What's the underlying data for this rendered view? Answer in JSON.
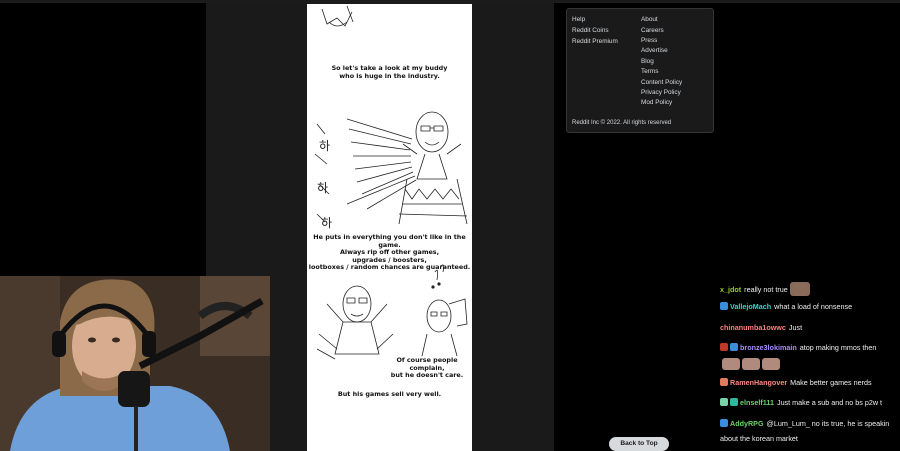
{
  "comic": {
    "captions": [
      {
        "lines": [
          "So let's take a look at my buddy",
          "who is huge in the industry."
        ]
      },
      {
        "lines": [
          "He puts in everything you don't like in the game.",
          "Always rip off other games,",
          "upgrades / boosters,",
          "lootboxes / random chances are guaranteed."
        ]
      },
      {
        "lines": [
          "Of course people complain,",
          "but he doesn't care."
        ]
      },
      {
        "lines": [
          "But his games sell very well."
        ]
      }
    ],
    "side_text": "하"
  },
  "footer": {
    "left_links": [
      "Help",
      "Reddit Coins",
      "Reddit Premium"
    ],
    "right_links": [
      "About",
      "Careers",
      "Press",
      "Advertise",
      "Blog",
      "Terms",
      "Content Policy",
      "Privacy Policy",
      "Mod Policy"
    ],
    "copyright": "Reddit Inc © 2022. All rights reserved"
  },
  "back_to_top": "Back to Top",
  "chat": {
    "messages": [
      {
        "user": "x_jdot",
        "text": "really not true",
        "color": "#9acd32"
      },
      {
        "user": "VallejoMach",
        "text": "what a load of nonsense",
        "color": "#3dd6c6"
      },
      {
        "user": "chinanumba1owwc",
        "text": "Just",
        "color": "#ff7f7f"
      },
      {
        "user": "bronze3lokimain",
        "text": "atop making mmos then",
        "color": "#a98cff"
      },
      {
        "user": "RamenHangover",
        "text": "Make better games nerds",
        "color": "#ff8a80"
      },
      {
        "user": "elnself111",
        "text": "Just make a sub and no bs p2w t",
        "color": "#6dd06d"
      },
      {
        "user": "AddyRPG",
        "text": "@Lum_Lum_ no its true, he is speakin",
        "color": "#6bd46b"
      },
      {
        "user": "",
        "text": "about the korean market",
        "color": "#ffffff"
      }
    ]
  }
}
